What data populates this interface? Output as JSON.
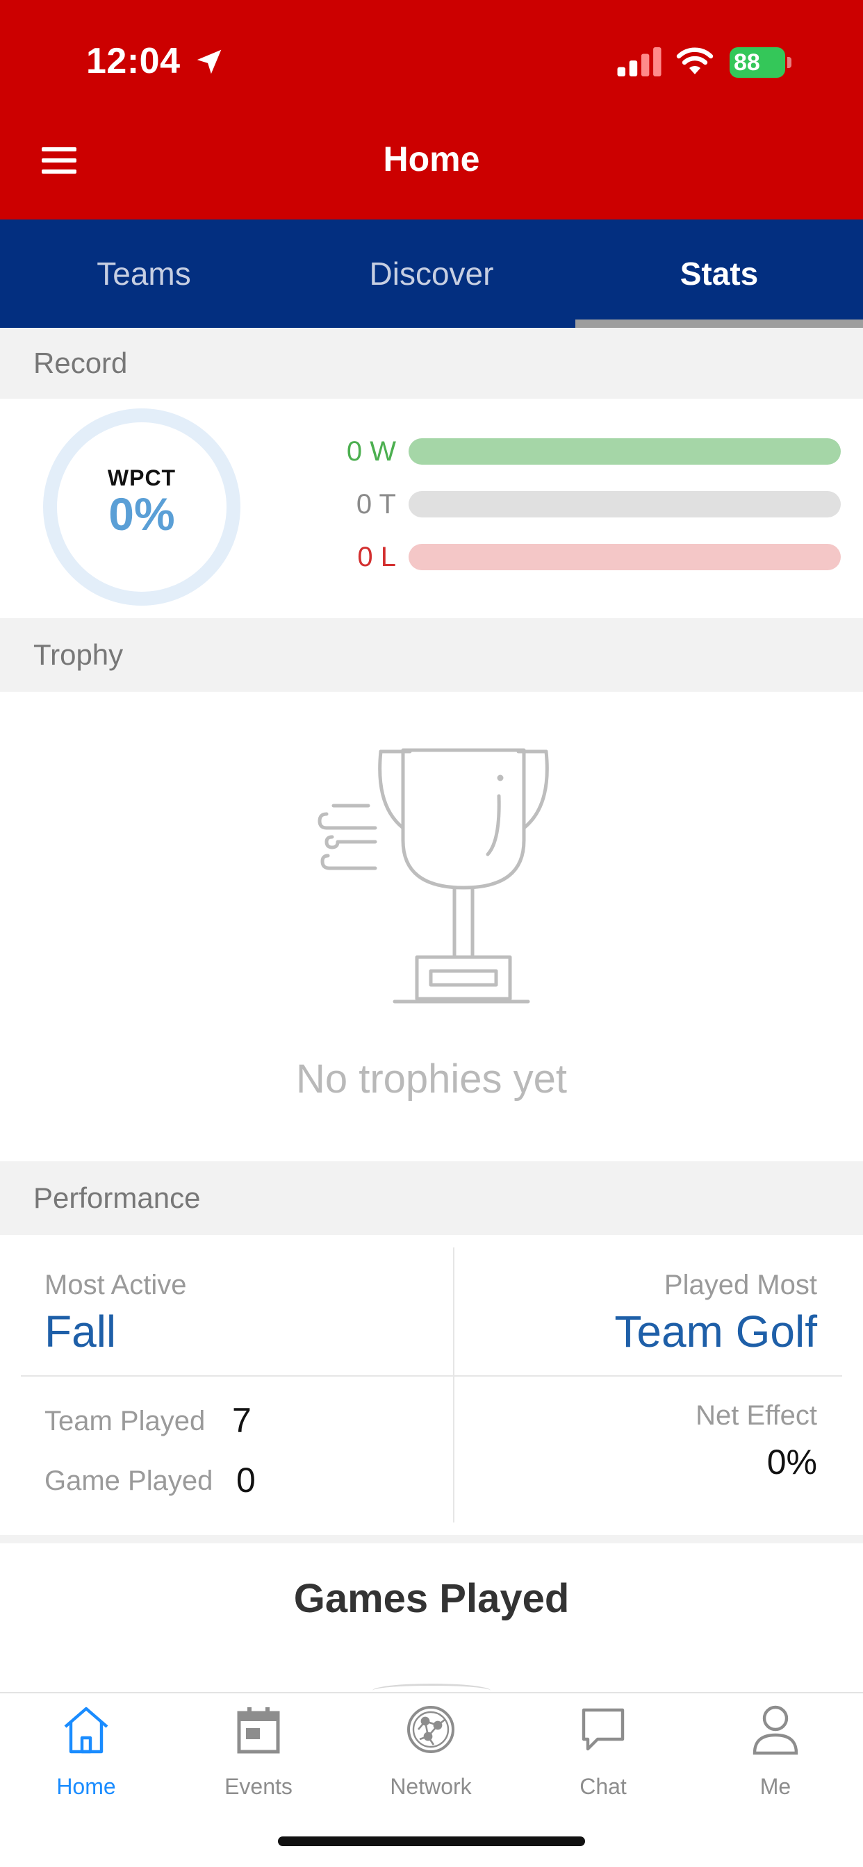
{
  "status_bar": {
    "time": "12:04",
    "battery": "88",
    "battery_color": "#34c759"
  },
  "header": {
    "title": "Home",
    "background": "#cc0000",
    "menu_icon": "hamburger-menu-icon"
  },
  "tabs": [
    {
      "label": "Teams",
      "active": false
    },
    {
      "label": "Discover",
      "active": false
    },
    {
      "label": "Stats",
      "active": true
    }
  ],
  "record": {
    "section_title": "Record",
    "wpct_label": "WPCT",
    "wpct_value": "0%",
    "rows": [
      {
        "label": "0 W",
        "color": "#4caf50",
        "bar_color": "#a5d6a7"
      },
      {
        "label": "0 T",
        "color": "#8a8a8a",
        "bar_color": "#e0e0e0"
      },
      {
        "label": "0 L",
        "color": "#d32f2f",
        "bar_color": "#f4c7c7"
      }
    ]
  },
  "trophy": {
    "section_title": "Trophy",
    "icon": "trophy-icon",
    "empty_text": "No trophies yet"
  },
  "performance": {
    "section_title": "Performance",
    "most_active_label": "Most Active",
    "most_active_value": "Fall",
    "played_most_label": "Played Most",
    "played_most_value": "Team Golf",
    "team_played_label": "Team Played",
    "team_played_value": "7",
    "game_played_label": "Game Played",
    "game_played_value": "0",
    "net_effect_label": "Net Effect",
    "net_effect_value": "0%"
  },
  "games_played": {
    "title": "Games Played"
  },
  "bottom_nav": [
    {
      "label": "Home",
      "icon": "home-icon",
      "active": true
    },
    {
      "label": "Events",
      "icon": "calendar-icon",
      "active": false
    },
    {
      "label": "Network",
      "icon": "network-icon",
      "active": false
    },
    {
      "label": "Chat",
      "icon": "chat-icon",
      "active": false
    },
    {
      "label": "Me",
      "icon": "person-icon",
      "active": false
    }
  ]
}
